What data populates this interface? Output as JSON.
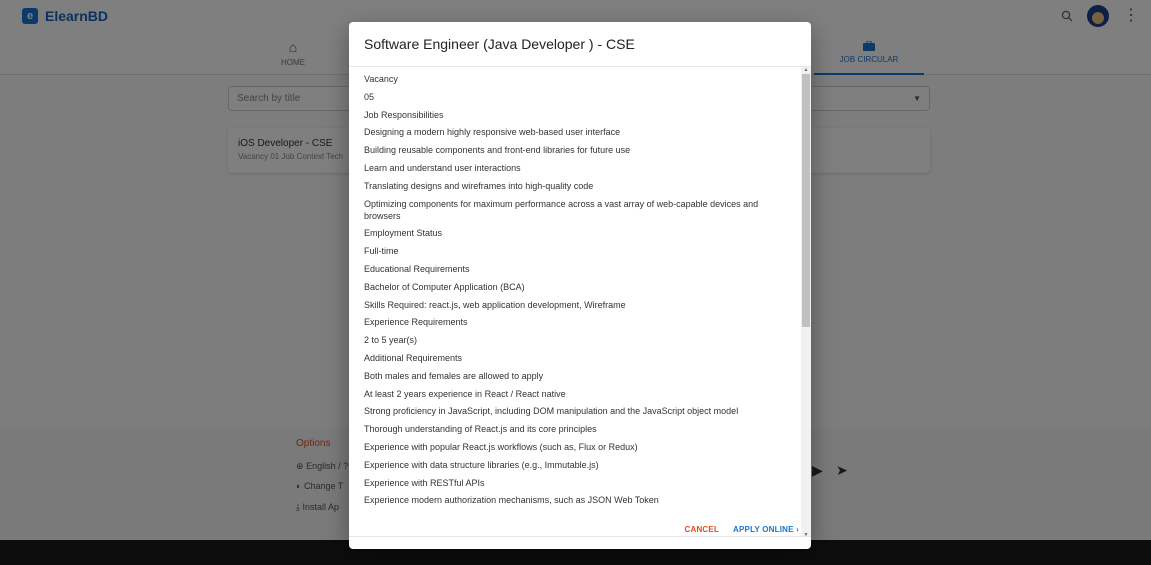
{
  "app": {
    "brand": "ElearnBD"
  },
  "nav": {
    "home_label": "HOME",
    "job_circular_label": "JOB CIRCULAR"
  },
  "search": {
    "placeholder": "Search by title"
  },
  "job_list": [
    {
      "title": "iOS Developer - CSE",
      "subtitle": "Vacancy 01 Job Context Tech"
    }
  ],
  "footer": {
    "options_title": "Options",
    "items": [
      "English / ?",
      "Change T",
      "Install Ap"
    ]
  },
  "dialog": {
    "title": "Software Engineer (Java Developer ) - CSE",
    "lines": [
      "Vacancy",
      "05",
      "Job Responsibilities",
      "Designing a modern highly responsive web-based user interface",
      "Building reusable components and front-end libraries for future use",
      "Learn and understand user interactions",
      "Translating designs and wireframes into high-quality code",
      "Optimizing components for maximum performance across a vast array of web-capable devices and browsers",
      "Employment Status",
      "Full-time",
      "Educational Requirements",
      "Bachelor of Computer Application (BCA)",
      "Skills Required: react.js, web application development, Wireframe",
      "Experience Requirements",
      "2 to 5 year(s)",
      "Additional Requirements",
      "Both males and females are allowed to apply",
      "At least 2 years experience in React / React native",
      "Strong proficiency in JavaScript, including DOM manipulation and the JavaScript object model",
      "Thorough understanding of React.js and its core principles",
      "Experience with popular React.js workflows (such as, Flux or Redux)",
      "Experience with data structure libraries (e.g., Immutable.js)",
      "Experience with RESTful APIs",
      "Experience modern authorization mechanisms, such as JSON Web Token"
    ],
    "cancel_label": "CANCEL",
    "apply_label": "APPLY ONLINE",
    "apply_chevron": "›"
  }
}
